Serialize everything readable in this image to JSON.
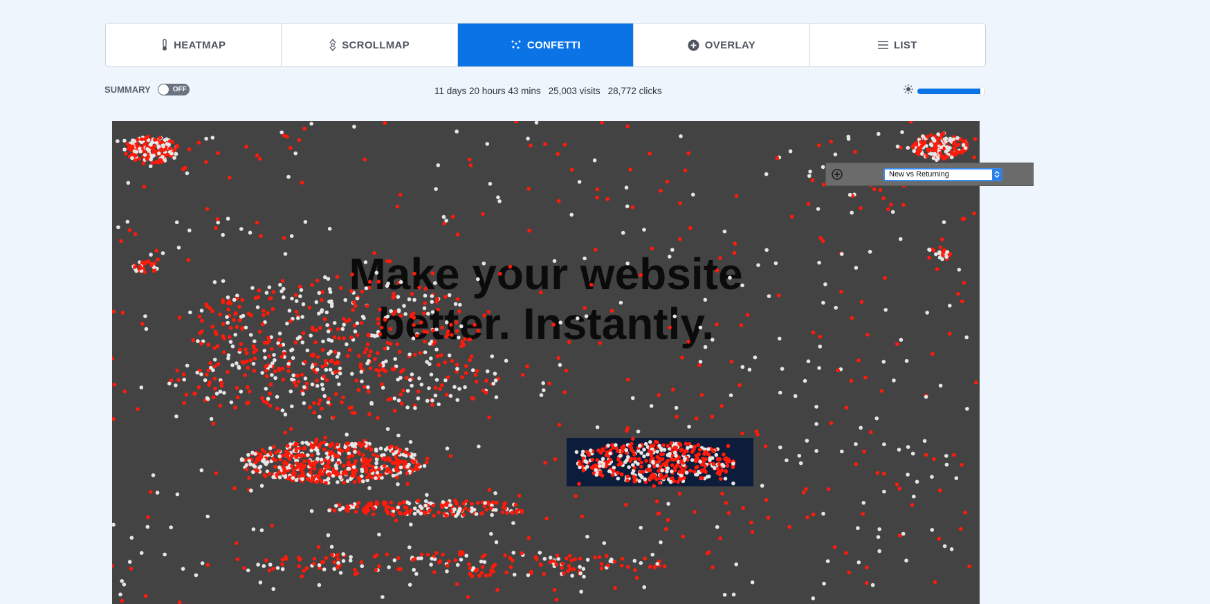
{
  "tabs": [
    {
      "label": "HEATMAP",
      "icon": "thermometer-icon",
      "active": false
    },
    {
      "label": "SCROLLMAP",
      "icon": "scroll-arrows-icon",
      "active": false
    },
    {
      "label": "CONFETTI",
      "icon": "confetti-icon",
      "active": true
    },
    {
      "label": "OVERLAY",
      "icon": "plus-circle-icon",
      "active": false
    },
    {
      "label": "LIST",
      "icon": "list-icon",
      "active": false
    }
  ],
  "summary": {
    "label": "SUMMARY",
    "toggle_state": "OFF"
  },
  "stats": {
    "duration": "11 days 20 hours 43 mins",
    "visits": "25,003 visits",
    "clicks": "28,772 clicks"
  },
  "brightness": {
    "icon": "sun-icon",
    "level": 0.96
  },
  "segment": {
    "add_icon": "plus-circle-icon",
    "selected": "New vs Returning"
  },
  "snapshot": {
    "title_line1": "Make your website",
    "title_line2": "better. Instantly."
  },
  "colors": {
    "accent": "#0a74e6",
    "canvas": "#434343",
    "click_new": "#ff1a0a",
    "click_returning": "#e6e6e6"
  }
}
